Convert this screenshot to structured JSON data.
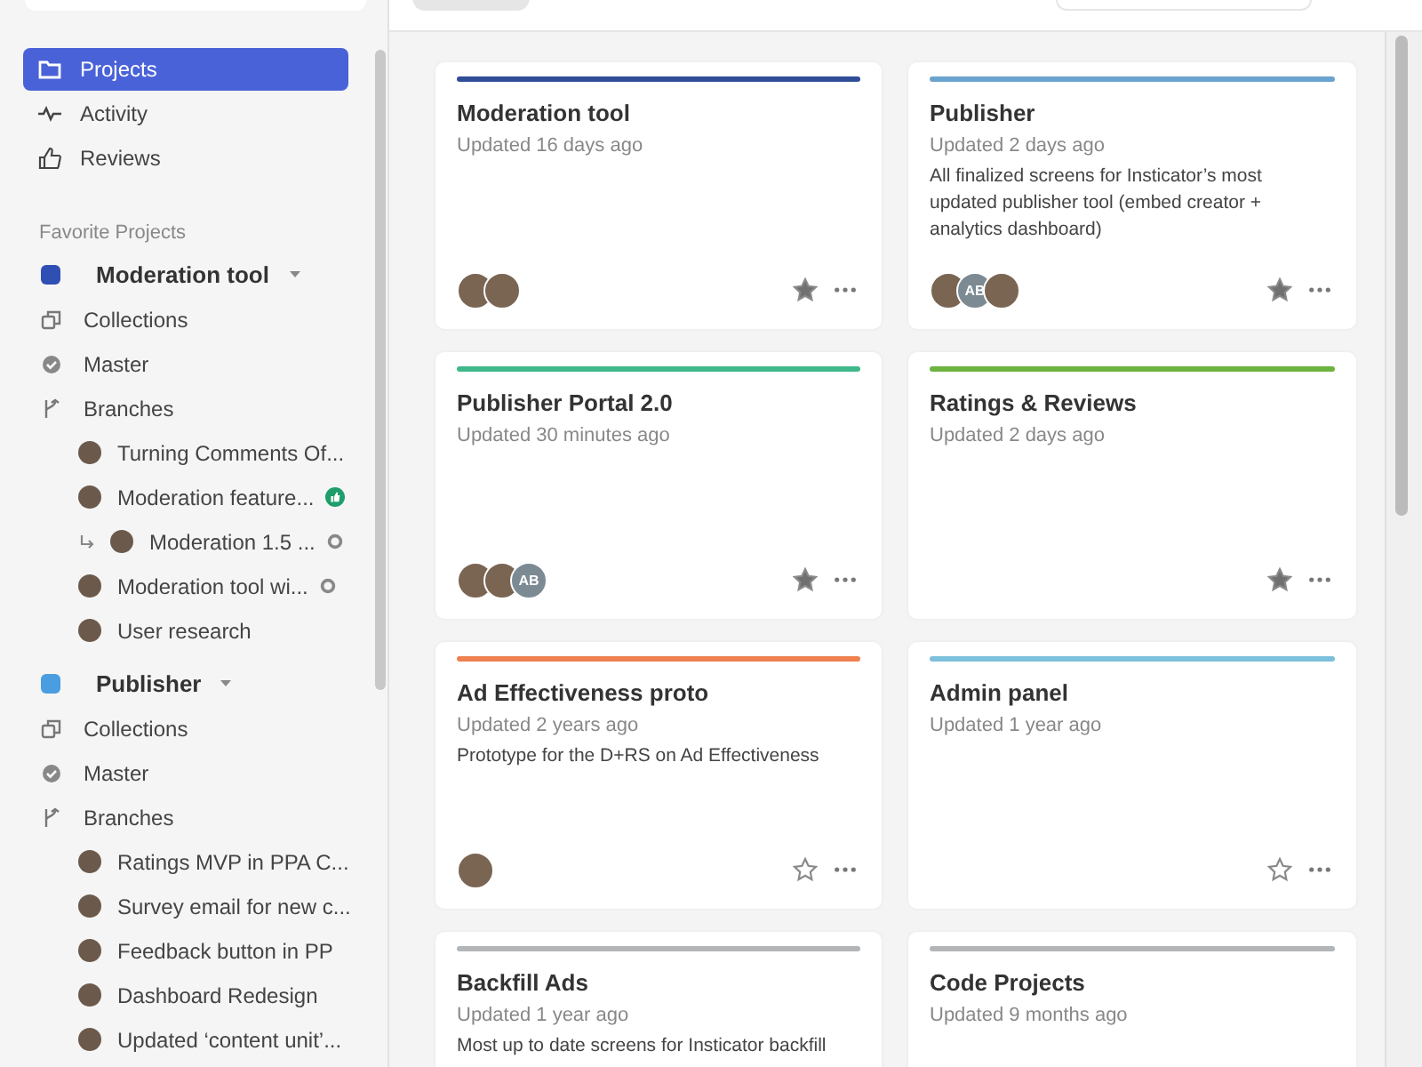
{
  "sidebar": {
    "nav": [
      {
        "label": "Projects",
        "selected": true
      },
      {
        "label": "Activity",
        "selected": false
      },
      {
        "label": "Reviews",
        "selected": false
      }
    ],
    "favorites_heading": "Favorite Projects",
    "favorites": [
      {
        "name": "Moderation tool",
        "color": "#2f4fb5",
        "expanded": true,
        "links": [
          {
            "label": "Collections",
            "kind": "collections"
          },
          {
            "label": "Master",
            "kind": "master"
          },
          {
            "label": "Branches",
            "kind": "branches"
          }
        ],
        "branches": [
          {
            "label": "Turning Comments Of...",
            "approved": false,
            "watching": false
          },
          {
            "label": "Moderation feature...",
            "approved": true,
            "watching": false,
            "children": [
              {
                "label": "Moderation 1.5 ...",
                "approved": false,
                "watching": true
              }
            ]
          },
          {
            "label": "Moderation tool wi...",
            "approved": false,
            "watching": true
          },
          {
            "label": "User research",
            "approved": false,
            "watching": false
          }
        ]
      },
      {
        "name": "Publisher",
        "color": "#4a9de0",
        "expanded": true,
        "links": [
          {
            "label": "Collections",
            "kind": "collections"
          },
          {
            "label": "Master",
            "kind": "master"
          },
          {
            "label": "Branches",
            "kind": "branches"
          }
        ],
        "branches": [
          {
            "label": "Ratings MVP in PPA C...",
            "approved": false,
            "watching": false
          },
          {
            "label": "Survey email for new c...",
            "approved": false,
            "watching": false
          },
          {
            "label": "Feedback button in PP",
            "approved": false,
            "watching": false
          },
          {
            "label": "Dashboard Redesign",
            "approved": false,
            "watching": false
          },
          {
            "label": "Updated ‘content unit’...",
            "approved": false,
            "watching": false
          }
        ]
      }
    ]
  },
  "cards": [
    {
      "title": "Moderation tool",
      "updated": "Updated 16 days ago",
      "color": "#2f4d96",
      "starred": true,
      "members": [
        {
          "kind": "photo"
        },
        {
          "kind": "photo"
        }
      ]
    },
    {
      "title": "Publisher",
      "updated": "Updated 2 days ago",
      "description": "All finalized screens for Insticator’s most updated publisher tool (embed creator + analytics dashboard)",
      "color": "#6aa3cf",
      "starred": true,
      "members": [
        {
          "kind": "photo"
        },
        {
          "kind": "initials",
          "text": "AB"
        },
        {
          "kind": "photo"
        }
      ]
    },
    {
      "title": "Publisher Portal 2.0",
      "updated": "Updated 30 minutes ago",
      "color": "#3fb98a",
      "starred": true,
      "members": [
        {
          "kind": "photo"
        },
        {
          "kind": "photo"
        },
        {
          "kind": "initials",
          "text": "AB"
        }
      ]
    },
    {
      "title": "Ratings & Reviews",
      "updated": "Updated 2 days ago",
      "color": "#6cb33f",
      "starred": true
    },
    {
      "title": "Ad Effectiveness proto",
      "updated": "Updated 2 years ago",
      "description": "Prototype for the D+RS on Ad Effectiveness",
      "color": "#ef8150",
      "starred": false,
      "members": [
        {
          "kind": "photo"
        }
      ]
    },
    {
      "title": "Admin panel",
      "updated": "Updated 1 year ago",
      "color": "#7cc0dc",
      "starred": false
    },
    {
      "title": "Backfill Ads",
      "updated": "Updated 1 year ago",
      "description": "Most up to date screens for Insticator backfill",
      "color": "#b3b6b8"
    },
    {
      "title": "Code Projects",
      "updated": "Updated 9 months ago",
      "color": "#b3b6b8"
    }
  ]
}
